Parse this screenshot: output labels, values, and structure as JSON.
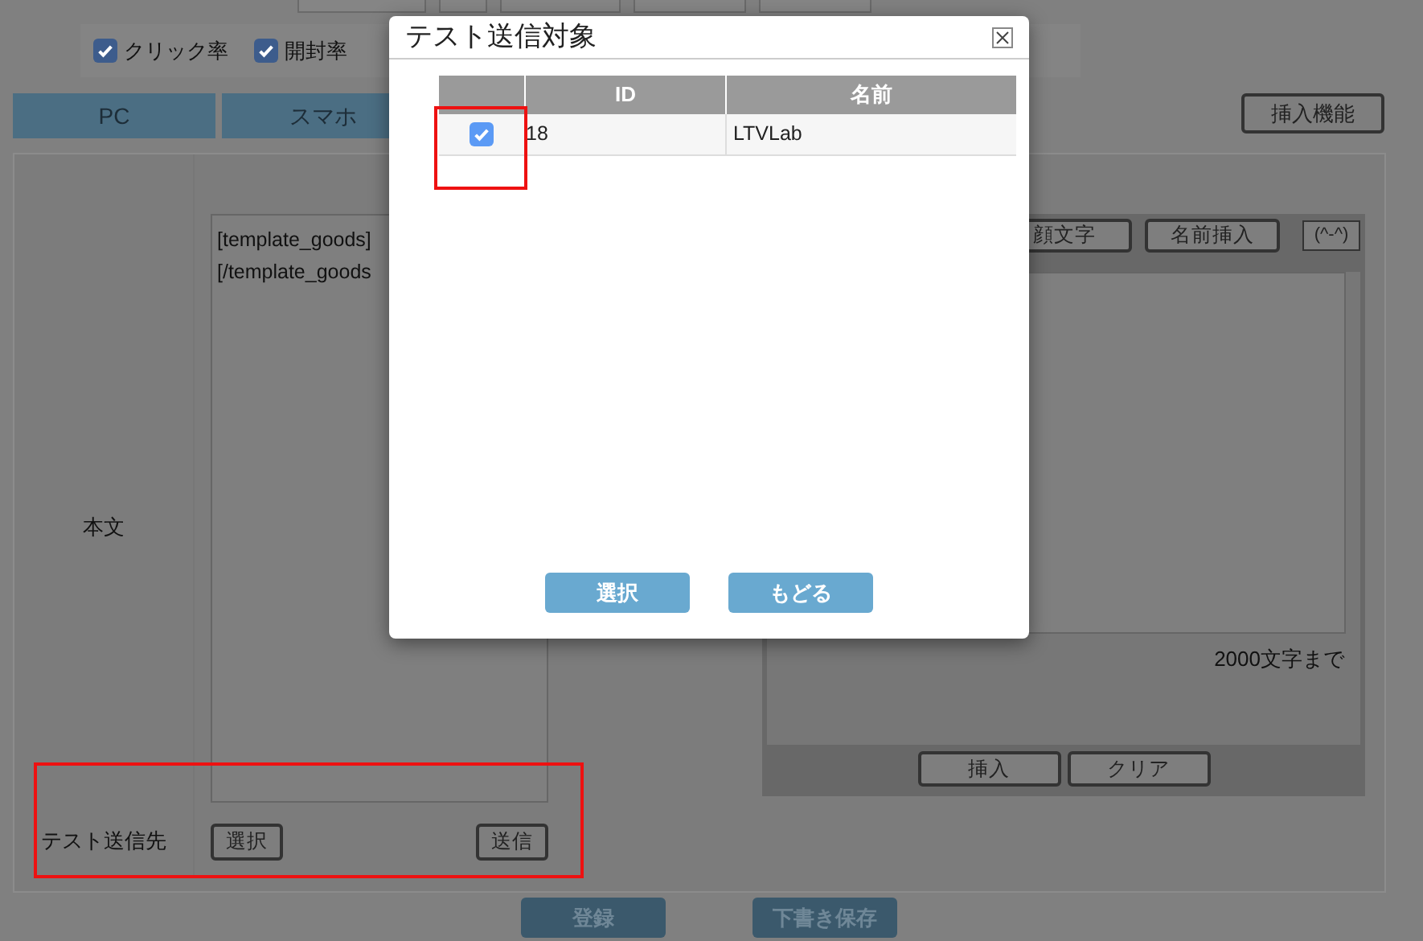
{
  "filters": [
    {
      "label": "クリック率",
      "checked": true
    },
    {
      "label": "開封率",
      "checked": true
    }
  ],
  "tabs": [
    {
      "label": "PC"
    },
    {
      "label": "スマホ"
    }
  ],
  "insert_feature_button": "挿入機能",
  "body": {
    "label": "本文",
    "text_lines": [
      "[template_goods]",
      "[/template_goods"
    ]
  },
  "editor": {
    "toolbar_buttons": [
      "顔文字",
      "名前挿入",
      "(^-^)"
    ],
    "char_limit": "2000文字まで",
    "buttons": [
      "挿入",
      "クリア"
    ]
  },
  "test_recipient": {
    "label": "テスト送信先",
    "select_button": "選択",
    "send_button": "送信"
  },
  "footer_buttons": [
    "登録",
    "下書き保存"
  ],
  "modal": {
    "title": "テスト送信対象",
    "columns": [
      "ID",
      "名前"
    ],
    "rows": [
      {
        "checked": true,
        "id": "18",
        "name": "LTVLab"
      }
    ],
    "buttons": [
      "選択",
      "もどる"
    ]
  }
}
